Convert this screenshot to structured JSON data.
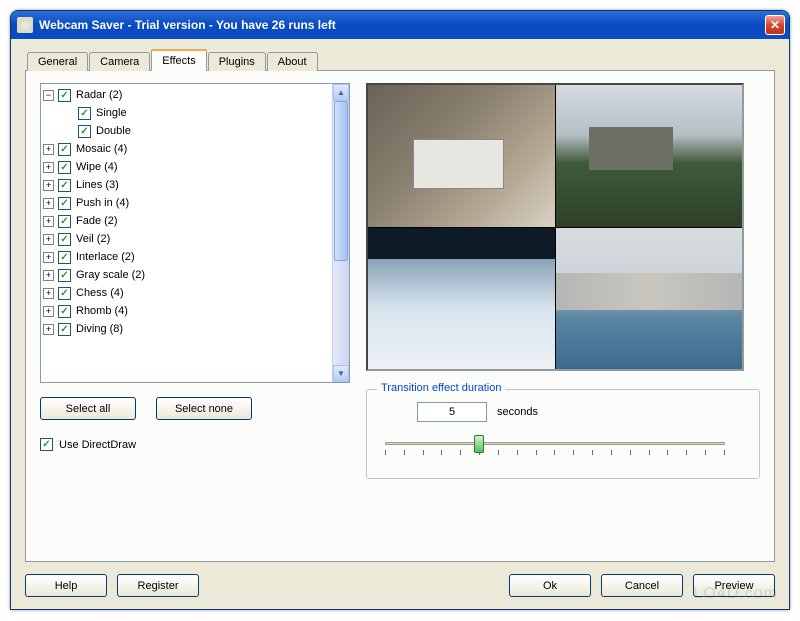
{
  "window": {
    "title": "Webcam Saver  - Trial version - You have 26 runs left"
  },
  "tabs": [
    {
      "label": "General",
      "active": false
    },
    {
      "label": "Camera",
      "active": false
    },
    {
      "label": "Effects",
      "active": true
    },
    {
      "label": "Plugins",
      "active": false
    },
    {
      "label": "About",
      "active": false
    }
  ],
  "tree": {
    "items": [
      {
        "glyph": "−",
        "indent": 0,
        "checked": true,
        "label": "Radar  (2)"
      },
      {
        "glyph": "",
        "indent": 1,
        "checked": true,
        "label": "Single"
      },
      {
        "glyph": "",
        "indent": 1,
        "checked": true,
        "label": "Double"
      },
      {
        "glyph": "+",
        "indent": 0,
        "checked": true,
        "label": "Mosaic  (4)"
      },
      {
        "glyph": "+",
        "indent": 0,
        "checked": true,
        "label": "Wipe  (4)"
      },
      {
        "glyph": "+",
        "indent": 0,
        "checked": true,
        "label": "Lines  (3)"
      },
      {
        "glyph": "+",
        "indent": 0,
        "checked": true,
        "label": "Push in  (4)"
      },
      {
        "glyph": "+",
        "indent": 0,
        "checked": true,
        "label": "Fade  (2)"
      },
      {
        "glyph": "+",
        "indent": 0,
        "checked": true,
        "label": "Veil  (2)"
      },
      {
        "glyph": "+",
        "indent": 0,
        "checked": true,
        "label": "Interlace  (2)"
      },
      {
        "glyph": "+",
        "indent": 0,
        "checked": true,
        "label": "Gray scale  (2)"
      },
      {
        "glyph": "+",
        "indent": 0,
        "checked": true,
        "label": "Chess  (4)"
      },
      {
        "glyph": "+",
        "indent": 0,
        "checked": true,
        "label": "Rhomb  (4)"
      },
      {
        "glyph": "+",
        "indent": 0,
        "checked": true,
        "label": "Diving  (8)"
      }
    ]
  },
  "buttons": {
    "select_all": "Select all",
    "select_none": "Select none"
  },
  "direct_draw": {
    "checked": true,
    "label": "Use DirectDraw"
  },
  "transition": {
    "legend": "Transition effect duration",
    "value": "5",
    "unit": "seconds",
    "min": 0,
    "max": 18,
    "tick_count": 19
  },
  "footer": {
    "help": "Help",
    "register": "Register",
    "ok": "Ok",
    "cancel": "Cancel",
    "preview": "Preview"
  },
  "watermark": "LO4D.com"
}
